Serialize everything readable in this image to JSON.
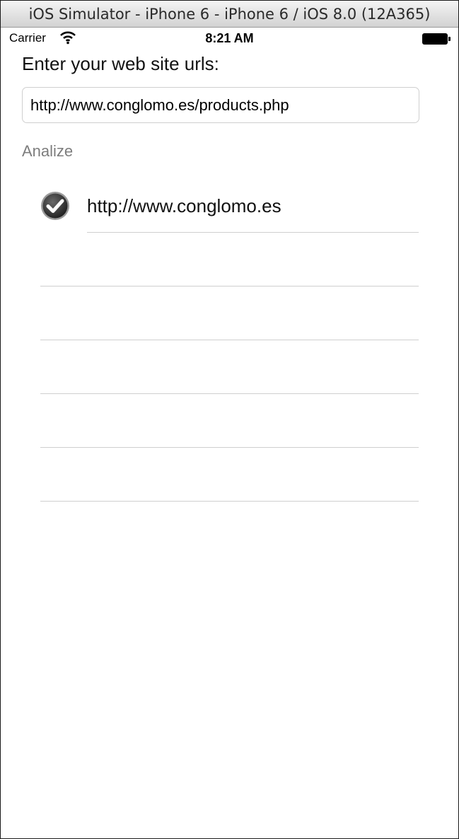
{
  "window": {
    "title": "iOS Simulator - iPhone 6 - iPhone 6 / iOS 8.0 (12A365)"
  },
  "status_bar": {
    "carrier": "Carrier",
    "time": "8:21 AM",
    "wifi_icon": "wifi-icon",
    "battery_icon": "battery-icon"
  },
  "form": {
    "prompt": "Enter your web site urls:",
    "url_value": "http://www.conglomo.es/products.php",
    "analize_label": "Analize"
  },
  "results": {
    "items": [
      {
        "label": "http://www.conglomo.es",
        "checked": true,
        "icon": "checkmark-circle-icon"
      },
      {
        "label": "",
        "checked": false
      },
      {
        "label": "",
        "checked": false
      },
      {
        "label": "",
        "checked": false
      },
      {
        "label": "",
        "checked": false
      },
      {
        "label": "",
        "checked": false
      }
    ]
  },
  "colors": {
    "analize_text": "#7d7d7d",
    "separator": "#cfcfcf",
    "check_fill": "#3a3a3a"
  }
}
